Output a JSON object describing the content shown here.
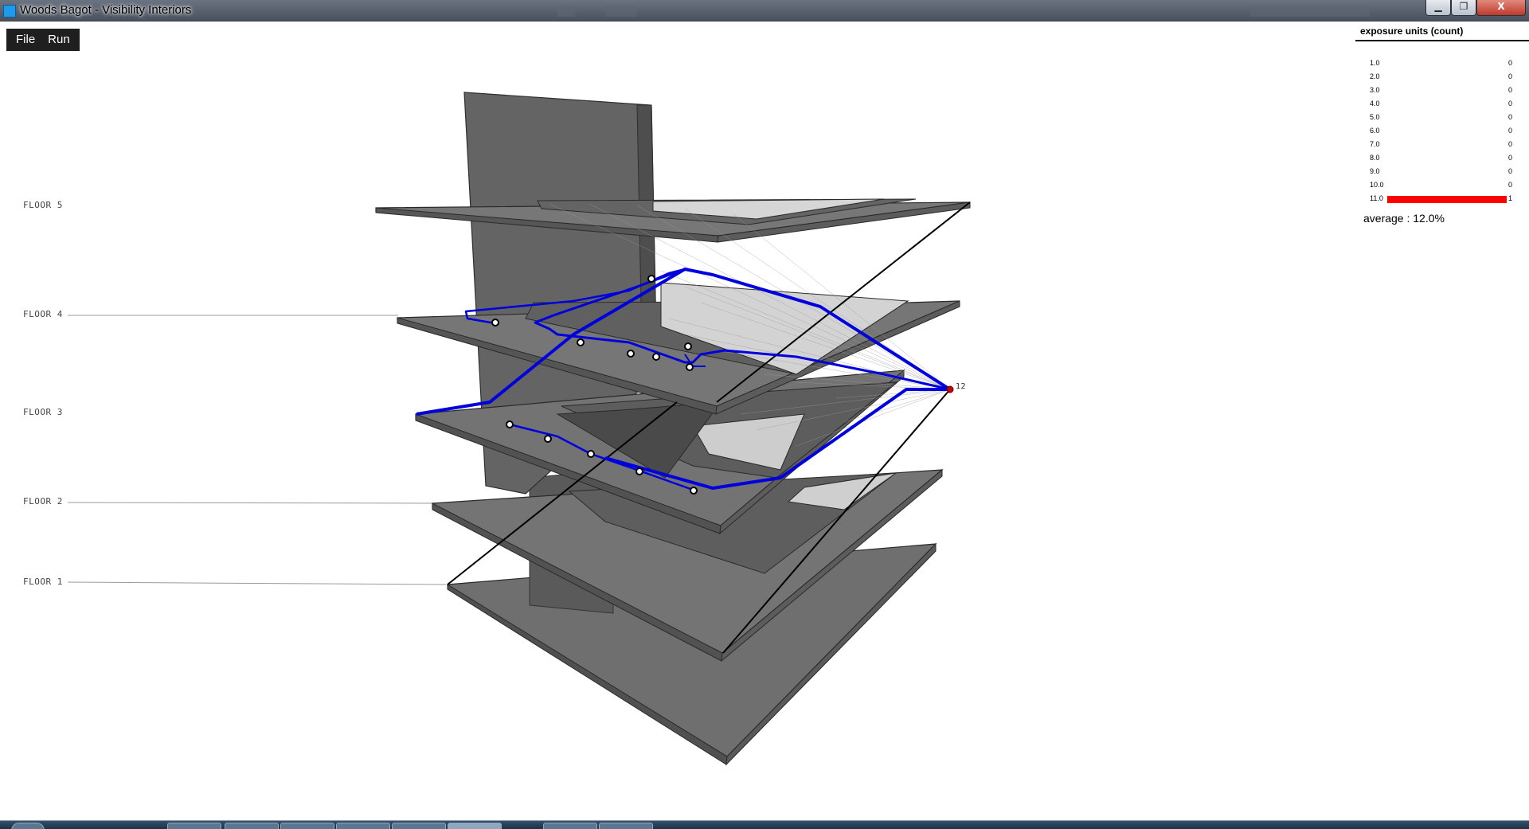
{
  "window": {
    "title": "Woods Bagot - Visibility Interiors",
    "controls": {
      "minimize": "▁",
      "maximize": "❐",
      "close": "X"
    }
  },
  "menu": [
    {
      "label": "File"
    },
    {
      "label": "Run"
    }
  ],
  "floors": [
    {
      "label": "FLOOR 5"
    },
    {
      "label": "FLOOR 4"
    },
    {
      "label": "FLOOR 3"
    },
    {
      "label": "FLOOR 2"
    },
    {
      "label": "FLOOR 1"
    }
  ],
  "viewpoint": {
    "label": "12"
  },
  "legend": {
    "title": "exposure units (count)",
    "max_count": 1,
    "rows": [
      {
        "key": "1.0",
        "count": "0",
        "value": 0
      },
      {
        "key": "2.0",
        "count": "0",
        "value": 0
      },
      {
        "key": "3.0",
        "count": "0",
        "value": 0
      },
      {
        "key": "4.0",
        "count": "0",
        "value": 0
      },
      {
        "key": "5.0",
        "count": "0",
        "value": 0
      },
      {
        "key": "6.0",
        "count": "0",
        "value": 0
      },
      {
        "key": "7.0",
        "count": "0",
        "value": 0
      },
      {
        "key": "8.0",
        "count": "0",
        "value": 0
      },
      {
        "key": "9.0",
        "count": "0",
        "value": 0
      },
      {
        "key": "10.0",
        "count": "0",
        "value": 0
      },
      {
        "key": "11.0",
        "count": "1",
        "value": 1
      }
    ],
    "bar_color": "#ff0000"
  },
  "summary": {
    "average": "average : 12.0%"
  },
  "colors": {
    "slab": "#6e6e6e",
    "slab_edge": "#2a2a2a",
    "path": "#0000dd",
    "viewpoint": "#cc0000"
  }
}
